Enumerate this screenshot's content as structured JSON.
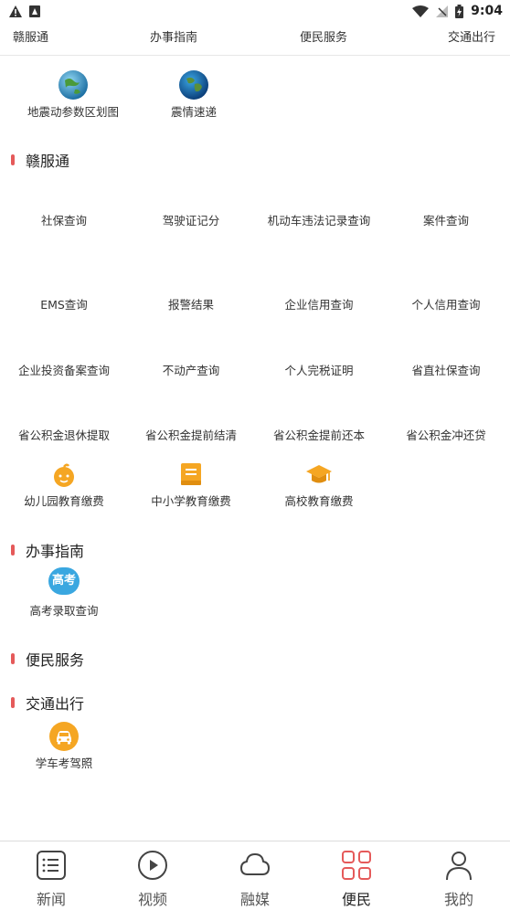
{
  "status_bar": {
    "time": "9:04",
    "icons": [
      "warning-icon",
      "sim-icon",
      "wifi-icon",
      "signal-icon",
      "battery-icon"
    ]
  },
  "top_tabs": [
    "赣服通",
    "办事指南",
    "便民服务",
    "交通出行"
  ],
  "quick_tiles": [
    {
      "label": "地震动参数区划图",
      "icon": "globe-icon"
    },
    {
      "label": "震情速递",
      "icon": "earth-icon"
    }
  ],
  "sections": {
    "ganfutong": {
      "title": "赣服通",
      "items": [
        "社保查询",
        "驾驶证记分",
        "机动车违法记录查询",
        "案件查询",
        "EMS查询",
        "报警结果",
        "企业信用查询",
        "个人信用查询",
        "企业投资备案查询",
        "不动产查询",
        "个人完税证明",
        "省直社保查询",
        "省公积金退休提取",
        "省公积金提前结清",
        "省公积金提前还本",
        "省公积金冲还贷"
      ],
      "fee_tiles": [
        {
          "label": "幼儿园教育缴费",
          "icon": "child-face-icon"
        },
        {
          "label": "中小学教育缴费",
          "icon": "book-icon"
        },
        {
          "label": "高校教育缴费",
          "icon": "graduation-cap-icon"
        }
      ]
    },
    "guide": {
      "title": "办事指南",
      "tiles": [
        {
          "label": "高考录取查询",
          "icon_text": "高考",
          "icon": "gaokao-badge-icon"
        }
      ]
    },
    "convenience": {
      "title": "便民服务"
    },
    "traffic": {
      "title": "交通出行",
      "tiles": [
        {
          "label": "学车考驾照",
          "icon": "car-icon"
        }
      ]
    }
  },
  "bottom_nav": [
    {
      "label": "新闻",
      "icon": "news-icon"
    },
    {
      "label": "视频",
      "icon": "play-icon"
    },
    {
      "label": "融媒",
      "icon": "cloud-icon"
    },
    {
      "label": "便民",
      "icon": "grid-icon",
      "active": true
    },
    {
      "label": "我的",
      "icon": "user-icon"
    }
  ],
  "colors": {
    "accent_red": "#e55a5a",
    "orange": "#f5a623",
    "blue": "#3aa7e0",
    "text": "#333333"
  }
}
